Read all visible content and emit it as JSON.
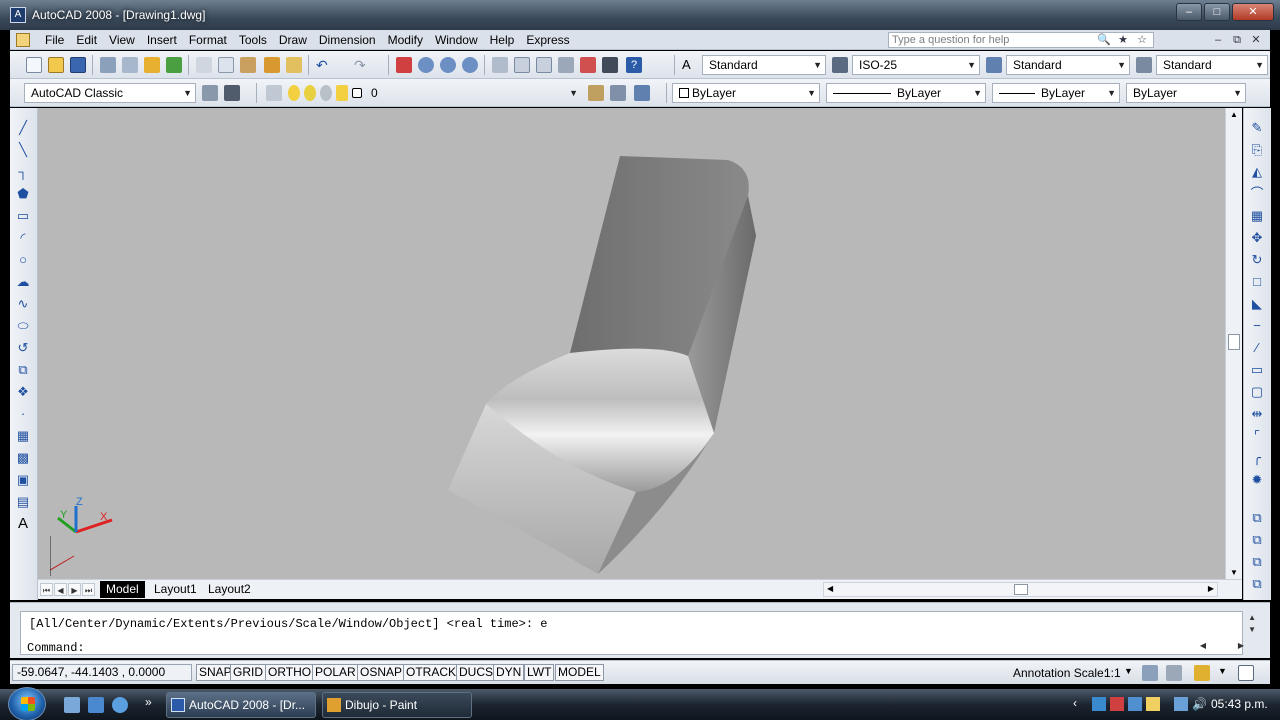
{
  "window": {
    "title": "AutoCAD 2008 - [Drawing1.dwg]",
    "controls": [
      "–",
      "□",
      "✕"
    ]
  },
  "menubar": {
    "items": [
      "File",
      "Edit",
      "View",
      "Insert",
      "Format",
      "Tools",
      "Draw",
      "Dimension",
      "Modify",
      "Window",
      "Help",
      "Express"
    ],
    "help_placeholder": "Type a question for help",
    "right_controls": [
      "–",
      "⧉",
      "✕"
    ]
  },
  "toolbar1": {
    "text_style": "Standard",
    "dim_style": "ISO-25",
    "table_style": "Standard",
    "mleader_style": "Standard"
  },
  "toolbar2": {
    "workspace": "AutoCAD Classic",
    "layer": "0",
    "color": "ByLayer",
    "linetype": "ByLayer",
    "lineweight": "ByLayer",
    "plotstyle": "ByLayer"
  },
  "viewport": {
    "ucs": {
      "x": "X",
      "y": "Y",
      "z": "Z"
    },
    "colors": {
      "background": "#b8b8b8",
      "x_axis": "#e02020",
      "y_axis": "#20a020",
      "z_axis": "#2070d0"
    }
  },
  "tabs": {
    "items": [
      "Model",
      "Layout1",
      "Layout2"
    ],
    "active": "Model"
  },
  "command": {
    "history": "[All/Center/Dynamic/Extents/Previous/Scale/Window/Object] <real time>: e",
    "prompt": "Command:"
  },
  "statusbar": {
    "coords": "-59.0647, -44.1403 , 0.0000",
    "toggles": [
      "SNAP",
      "GRID",
      "ORTHO",
      "POLAR",
      "OSNAP",
      "OTRACK",
      "DUCS",
      "DYN",
      "LWT",
      "MODEL"
    ],
    "annotation_scale_label": "Annotation Scale:",
    "annotation_scale_value": "1:1"
  },
  "taskbar": {
    "tasks": [
      {
        "label": "AutoCAD 2008 - [Dr...",
        "active": true
      },
      {
        "label": "Dibujo - Paint",
        "active": false
      }
    ],
    "clock": "05:43 p.m."
  }
}
